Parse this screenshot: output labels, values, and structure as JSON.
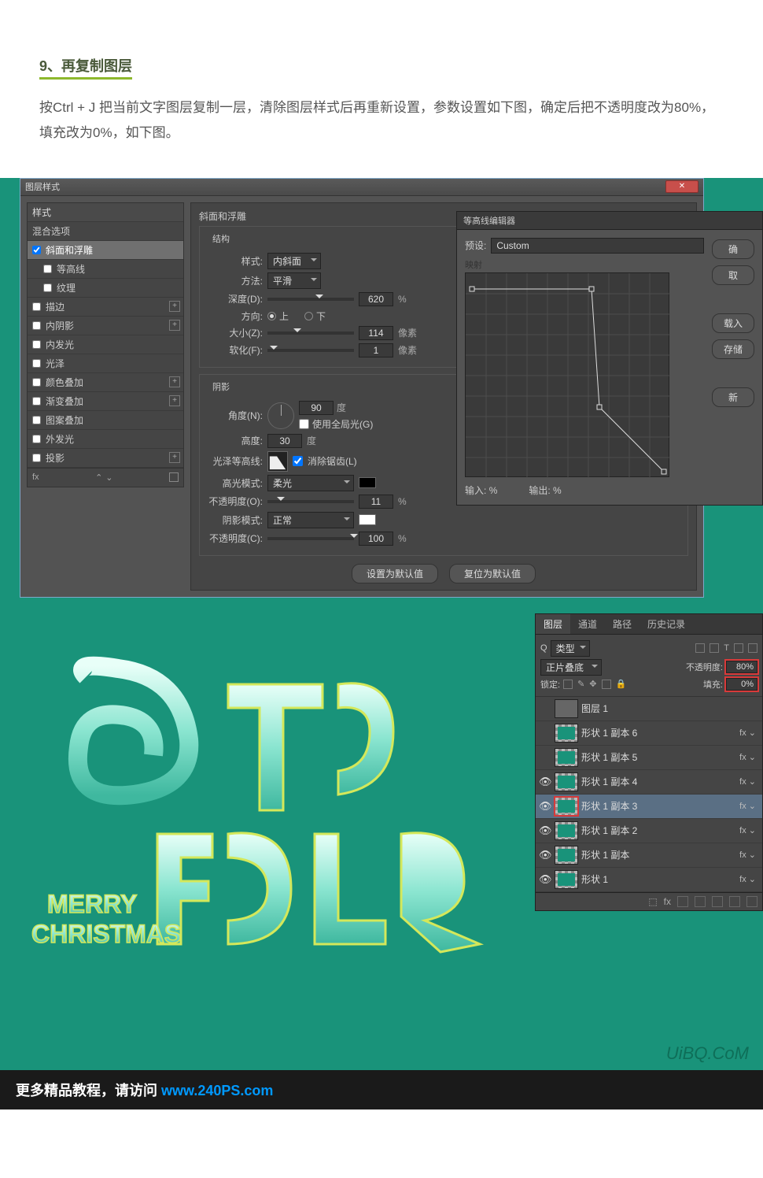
{
  "step": {
    "title": "9、再复制图层"
  },
  "description": "按Ctrl + J 把当前文字图层复制一层，清除图层样式后再重新设置，参数设置如下图，确定后把不透明度改为80%，填充改为0%，如下图。",
  "layerStyleDialog": {
    "title": "图层样式",
    "styles_header": "样式",
    "blend_options": "混合选项",
    "items": [
      {
        "label": "斜面和浮雕",
        "checked": true,
        "active": true
      },
      {
        "label": "等高线",
        "checked": false,
        "indent": true
      },
      {
        "label": "纹理",
        "checked": false,
        "indent": true
      },
      {
        "label": "描边",
        "checked": false,
        "plus": true
      },
      {
        "label": "内阴影",
        "checked": false,
        "plus": true
      },
      {
        "label": "内发光",
        "checked": false
      },
      {
        "label": "光泽",
        "checked": false
      },
      {
        "label": "颜色叠加",
        "checked": false,
        "plus": true
      },
      {
        "label": "渐变叠加",
        "checked": false,
        "plus": true
      },
      {
        "label": "图案叠加",
        "checked": false
      },
      {
        "label": "外发光",
        "checked": false
      },
      {
        "label": "投影",
        "checked": false,
        "plus": true
      }
    ],
    "footer_fx": "fx",
    "bevel": {
      "section": "斜面和浮雕",
      "structure": "结构",
      "style_label": "样式:",
      "style_value": "内斜面",
      "technique_label": "方法:",
      "technique_value": "平滑",
      "depth_label": "深度(D):",
      "depth_value": "620",
      "depth_unit": "%",
      "direction_label": "方向:",
      "dir_up": "上",
      "dir_down": "下",
      "size_label": "大小(Z):",
      "size_value": "114",
      "size_unit": "像素",
      "soften_label": "软化(F):",
      "soften_value": "1",
      "soften_unit": "像素",
      "shading": "阴影",
      "angle_label": "角度(N):",
      "angle_value": "90",
      "angle_unit": "度",
      "global_light": "使用全局光(G)",
      "altitude_label": "高度:",
      "altitude_value": "30",
      "altitude_unit": "度",
      "gloss_contour_label": "光泽等高线:",
      "antialias": "消除锯齿(L)",
      "highlight_mode_label": "高光模式:",
      "highlight_mode_value": "柔光",
      "highlight_opacity_label": "不透明度(O):",
      "highlight_opacity_value": "11",
      "pct": "%",
      "shadow_mode_label": "阴影模式:",
      "shadow_mode_value": "正常",
      "shadow_opacity_label": "不透明度(C):",
      "shadow_opacity_value": "100",
      "default_btn": "设置为默认值",
      "reset_btn": "复位为默认值"
    }
  },
  "contourEditor": {
    "title": "等高线编辑器",
    "preset_label": "预设:",
    "preset_value": "Custom",
    "mapping": "映射",
    "input_label": "输入:",
    "output_label": "输出:",
    "pct": "%",
    "buttons": {
      "ok": "确",
      "cancel": "取",
      "load": "载入",
      "save": "存储",
      "new": "新"
    }
  },
  "resultPanel": {
    "tabs": {
      "layers": "图层",
      "channels": "通道",
      "paths": "路径",
      "history": "历史记录"
    },
    "kind_label": "类型",
    "search": "Q",
    "blend_mode": "正片叠底",
    "opacity_label": "不透明度:",
    "opacity_value": "80%",
    "lock_label": "锁定:",
    "fill_label": "填充:",
    "fill_value": "0%",
    "layers": [
      {
        "name": "图层 1",
        "eye": false,
        "thumb": "gray"
      },
      {
        "name": "形状 1 副本 6",
        "eye": false,
        "fx": true
      },
      {
        "name": "形状 1 副本 5",
        "eye": false,
        "fx": true
      },
      {
        "name": "形状 1 副本 4",
        "eye": true,
        "fx": true
      },
      {
        "name": "形状 1 副本 3",
        "eye": true,
        "fx": true,
        "selected": true
      },
      {
        "name": "形状 1 副本 2",
        "eye": true,
        "fx": true
      },
      {
        "name": "形状 1 副本",
        "eye": true,
        "fx": true
      },
      {
        "name": "形状 1",
        "eye": true,
        "fx": true
      }
    ]
  },
  "artwork": {
    "line1": "MERRY",
    "line2": "CHRISTMAS"
  },
  "watermark": "UiBQ.CoM",
  "footer": {
    "text": "更多精品教程，请访问 ",
    "link": "www.240PS.com"
  }
}
